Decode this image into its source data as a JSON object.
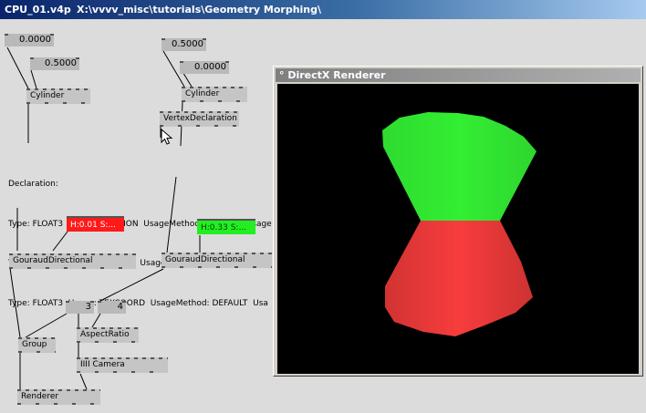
{
  "window": {
    "filename": "CPU_01.v4p",
    "path": "X:\\vvvv_misc\\tutorials\\Geometry Morphing\\"
  },
  "left_chain": {
    "io_a": "0.0000",
    "io_b": "0.5000",
    "cylinder_label": "Cylinder",
    "color_label": "H:0.01  S:...",
    "color": "#ff1a1a",
    "gouraud_label": "GouraudDirectional"
  },
  "right_chain": {
    "io_a": "0.5000",
    "io_b": "0.0000",
    "cylinder_label": "Cylinder",
    "vertex_decl_label": "VertexDeclaration",
    "color_label": "H:0.33  S:...",
    "color": "#22ee22",
    "gouraud_label": "GouraudDirectional"
  },
  "declaration": {
    "heading": "Declaration:",
    "lines": [
      "Type: FLOAT3  Usage: POSITION  UsageMethod: DEFAULT  Usage",
      "Type: FLOAT3  Usage: NORMAL  UsageMethod: DEFAULT  Usage",
      "Type: FLOAT3  Usage: TEXCOORD  UsageMethod: DEFAULT  Usa"
    ]
  },
  "bottom": {
    "group_label": "Group",
    "aspect_x": "3",
    "aspect_y": "4",
    "aspect_label": "AspectRatio",
    "camera_label": "IIII  Camera",
    "renderer_label": "Renderer"
  },
  "renderer_window": {
    "title": "° DirectX Renderer",
    "background": "#000000",
    "top_color": "#33ee33",
    "bottom_color": "#ee3a3a"
  },
  "icons": [
    "mouse-pointer-icon"
  ]
}
